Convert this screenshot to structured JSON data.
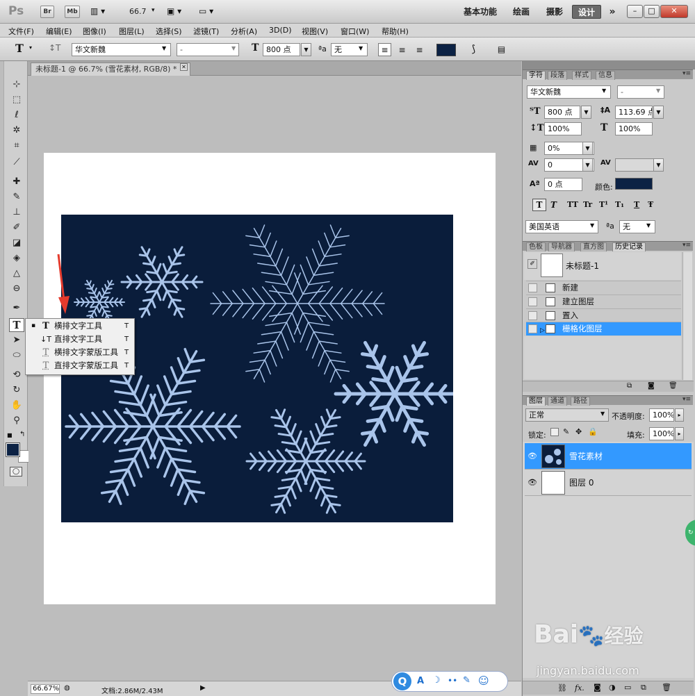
{
  "appbar": {
    "logo": "Ps",
    "bridge_btn": "Br",
    "minibridge_btn": "Mb",
    "zoom_display": "66.7",
    "workspaces": [
      "基本功能",
      "绘画",
      "摄影",
      "设计"
    ],
    "more_workspaces": "»",
    "window_controls": [
      "–",
      "□",
      "✕"
    ]
  },
  "menu": [
    "文件(F)",
    "编辑(E)",
    "图像(I)",
    "图层(L)",
    "选择(S)",
    "滤镜(T)",
    "分析(A)",
    "3D(D)",
    "视图(V)",
    "窗口(W)",
    "帮助(H)"
  ],
  "options": {
    "tool_icon": "T",
    "font_family": "华文新魏",
    "font_style": "-",
    "size_icon": "T",
    "font_size": "800 点",
    "aa_icon": "ªa",
    "aa_mode": "无",
    "swatch_color": "#0c2244"
  },
  "document": {
    "tab_title": "未标题-1 @ 66.7% (雪花素材, RGB/8) *",
    "close": "✕"
  },
  "flyout": {
    "items": [
      {
        "bullet": "▪",
        "icon": "T",
        "label": "横排文字工具",
        "key": "T"
      },
      {
        "bullet": "",
        "icon": "↓T",
        "label": "直排文字工具",
        "key": "T"
      },
      {
        "bullet": "",
        "icon": "T",
        "label": "横排文字蒙版工具",
        "key": "T"
      },
      {
        "bullet": "",
        "icon": "T",
        "label": "直排文字蒙版工具",
        "key": "T"
      }
    ]
  },
  "character_panel": {
    "tabs": [
      "字符",
      "段落",
      "样式",
      "信息"
    ],
    "font_family": "华文新魏",
    "font_style": "-",
    "font_size": "800 点",
    "leading": "113.69 点",
    "vertical_scale": "100%",
    "horizontal_scale": "100%",
    "tsume": "0%",
    "kerning": "0",
    "tracking": "",
    "baseline_shift": "0 点",
    "color_label": "颜色:",
    "color": "#0c2244",
    "style_buttons": [
      "T",
      "T",
      "TT",
      "Tr",
      "T¹",
      "T₁",
      "T",
      "Ŧ"
    ],
    "language": "美国英语",
    "aa_icon": "ªa",
    "aa_mode": "无"
  },
  "history_panel": {
    "tabs": [
      "色板",
      "导航器",
      "直方图",
      "历史记录"
    ],
    "snapshot": "未标题-1",
    "states": [
      "新建",
      "建立图层",
      "置入",
      "栅格化图层"
    ],
    "selected_index": 3
  },
  "layers_panel": {
    "tabs": [
      "图层",
      "通道",
      "路径"
    ],
    "blend_mode": "正常",
    "opacity_label": "不透明度:",
    "opacity": "100%",
    "lock_label": "锁定:",
    "fill_label": "填充:",
    "fill": "100%",
    "layers": [
      {
        "name": "雪花素材",
        "selected": true
      },
      {
        "name": "图层 0",
        "selected": false
      }
    ],
    "footer_icons": [
      "link-icon",
      "fx-icon",
      "mask-icon",
      "adjustment-icon",
      "group-icon",
      "new-layer-icon",
      "trash-icon"
    ],
    "fx_label": "fx."
  },
  "status": {
    "zoom": "66.67%",
    "doc_info": "文档:2.86M/2.43M"
  },
  "watermark": {
    "brand": "Bai",
    "brand_cn": "经验",
    "url": "jingyan.baidu.com"
  },
  "qq_bar": {
    "glyphs": [
      "Q",
      "A",
      "☽",
      "••",
      "✎",
      "☺"
    ]
  },
  "colors": {
    "canvas_bg": "#0a1d3b",
    "snow": "#a9c4ea",
    "selection": "#3399ff",
    "arrow": "#e53b2d"
  }
}
